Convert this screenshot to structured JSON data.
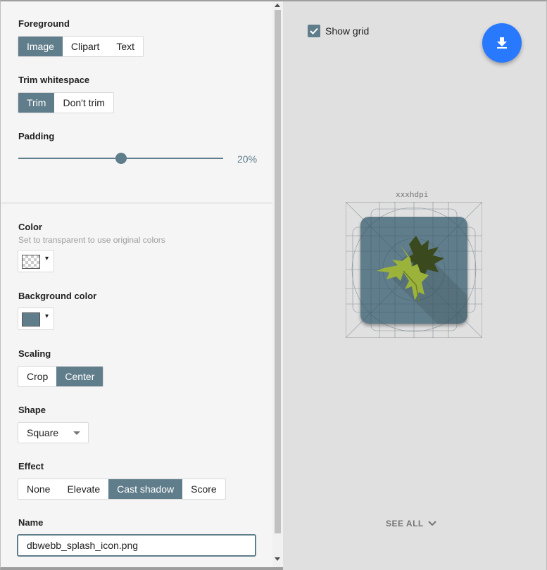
{
  "foreground": {
    "label": "Foreground",
    "options": [
      "Image",
      "Clipart",
      "Text"
    ],
    "selected": "Image"
  },
  "trim": {
    "label": "Trim whitespace",
    "options": [
      "Trim",
      "Don't trim"
    ],
    "selected": "Trim"
  },
  "padding": {
    "label": "Padding",
    "value_text": "20%",
    "value": 20
  },
  "color": {
    "label": "Color",
    "hint": "Set to transparent to use original colors",
    "value": "transparent",
    "arrow": "▾"
  },
  "background_color": {
    "label": "Background color",
    "value": "#607d8b",
    "arrow": "▾"
  },
  "scaling": {
    "label": "Scaling",
    "options": [
      "Crop",
      "Center"
    ],
    "selected": "Center"
  },
  "shape": {
    "label": "Shape",
    "value": "Square"
  },
  "effect": {
    "label": "Effect",
    "options": [
      "None",
      "Elevate",
      "Cast shadow",
      "Score"
    ],
    "selected": "Cast shadow"
  },
  "name": {
    "label": "Name",
    "value": "dbwebb_splash_icon.png"
  },
  "preview": {
    "show_grid_label": "Show grid",
    "show_grid_checked": true,
    "density_label": "xxxhdpi",
    "see_all_label": "SEE ALL",
    "download_icon": "download-icon"
  },
  "colors": {
    "accent": "#607d8b",
    "fab": "#2979ff"
  }
}
